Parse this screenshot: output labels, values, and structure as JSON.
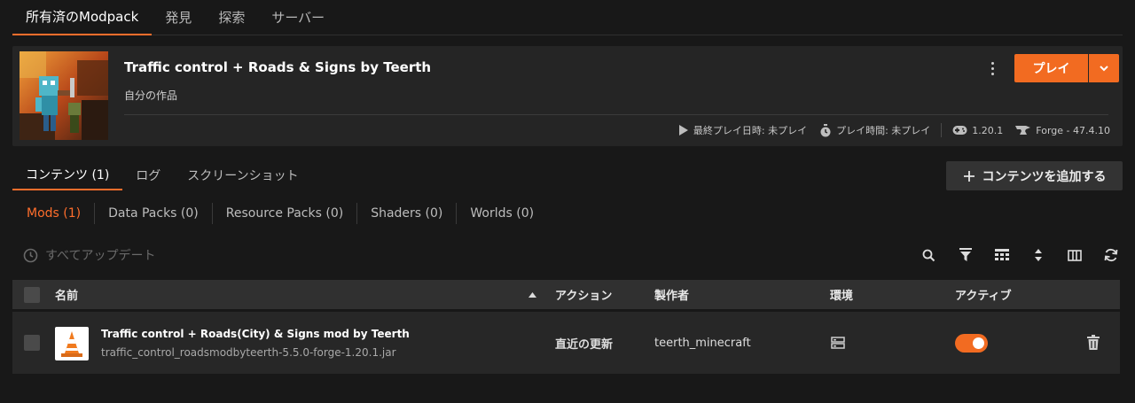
{
  "top_tabs": [
    "所有済のModpack",
    "発見",
    "探索",
    "サーバー"
  ],
  "pack": {
    "title": "Traffic control + Roads & Signs by Teerth",
    "subtitle": "自分の作品",
    "play_label": "プレイ",
    "last_played": "最終プレイ日時: 未プレイ",
    "play_time": "プレイ時間: 未プレイ",
    "game_version": "1.20.1",
    "loader": "Forge - 47.4.10"
  },
  "sub_tabs": [
    "コンテンツ (1)",
    "ログ",
    "スクリーンショット"
  ],
  "add_content_label": "コンテンツを追加する",
  "filters": [
    "Mods (1)",
    "Data Packs (0)",
    "Resource Packs (0)",
    "Shaders (0)",
    "Worlds (0)"
  ],
  "update_all_label": "すべてアップデート",
  "table": {
    "headers": {
      "name": "名前",
      "action": "アクション",
      "author": "製作者",
      "environment": "環境",
      "active": "アクティブ"
    },
    "rows": [
      {
        "name": "Traffic control + Roads(City) & Signs mod by Teerth",
        "file": "traffic_control_roadsmodbyteerth-5.5.0-forge-1.20.1.jar",
        "action": "直近の更新",
        "author": "teerth_minecraft",
        "active": true
      }
    ]
  },
  "colors": {
    "accent": "#ff6e2c",
    "background": "#181818",
    "card": "#252525"
  },
  "icons": [
    "more-vertical-icon",
    "chevron-down-icon",
    "play-triangle-icon",
    "stopwatch-icon",
    "gamepad-icon",
    "anvil-icon",
    "plus-icon",
    "clock-icon",
    "search-icon",
    "filter-icon",
    "table-icon",
    "sort-icon",
    "columns-icon",
    "refresh-icon",
    "sort-asc-icon",
    "server-icon",
    "trash-icon",
    "traffic-cone-icon"
  ]
}
